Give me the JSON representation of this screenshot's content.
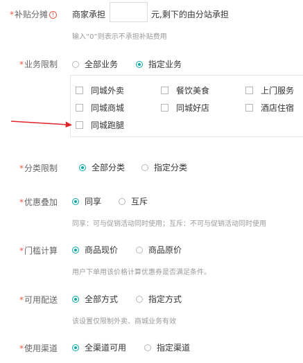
{
  "subsidy": {
    "label": "补贴分摊",
    "merchant": "商家承担",
    "input_value": "",
    "suffix": "元,剩下的由分站承担",
    "hint": "输入“0”则表示不承担补贴费用"
  },
  "business": {
    "label": "业务限制",
    "options": [
      "全部业务",
      "指定业务"
    ],
    "selected": 1,
    "checkboxes": [
      "同城外卖",
      "餐饮美食",
      "上门服务",
      "同城商城",
      "同城好店",
      "酒店住宿",
      "同城跑腿"
    ]
  },
  "category": {
    "label": "分类限制",
    "options": [
      "全部分类",
      "指定分类"
    ],
    "selected": 0
  },
  "discount": {
    "label": "优惠叠加",
    "options": [
      "同享",
      "互斥"
    ],
    "selected": 0,
    "hint": "同享：可与促销活动同时使用；互斥：不可与促销活动同时使用"
  },
  "threshold": {
    "label": "门槛计算",
    "options": [
      "商品现价",
      "商品原价"
    ],
    "selected": 0,
    "hint": "用户下单用该价格计算优惠券是否满足条件。"
  },
  "delivery": {
    "label": "可用配送",
    "options": [
      "全部方式",
      "指定方式"
    ],
    "selected": 0,
    "hint": "该设置仅限制外卖、商城业务有效"
  },
  "channel": {
    "label": "使用渠道",
    "options": [
      "全渠道可用",
      "指定渠道"
    ],
    "selected": 0
  },
  "colors": {
    "accent": "#0aa8a8",
    "required": "#e85a47",
    "arrow": "#e0242a"
  },
  "icons": {
    "info": "info-circle-icon",
    "arrow": "red-arrow-annotation"
  }
}
